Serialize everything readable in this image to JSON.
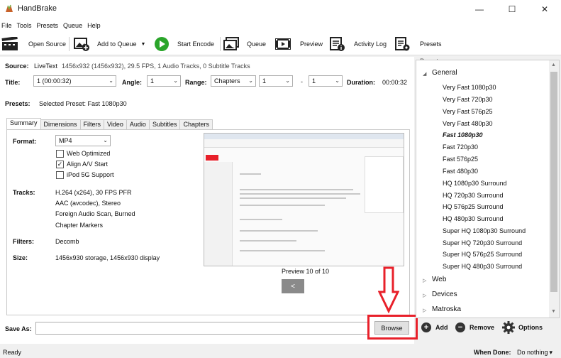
{
  "window": {
    "title": "HandBrake",
    "minimize": "—",
    "maximize": "☐",
    "close": "✕"
  },
  "menu": [
    "File",
    "Tools",
    "Presets",
    "Queue",
    "Help"
  ],
  "toolbar": {
    "open_source": "Open Source",
    "add_to_queue": "Add to Queue",
    "add_to_queue_arrow": "▼",
    "start_encode": "Start Encode",
    "queue": "Queue",
    "preview": "Preview",
    "activity_log": "Activity Log",
    "presets": "Presets"
  },
  "source": {
    "label": "Source:",
    "name": "LiveText",
    "info": "1456x932 (1456x932), 29.5 FPS, 1 Audio Tracks, 0 Subtitle Tracks"
  },
  "title_row": {
    "title_label": "Title:",
    "title_value": "1 (00:00:32)",
    "angle_label": "Angle:",
    "angle_value": "1",
    "range_label": "Range:",
    "range_mode": "Chapters",
    "range_start": "1",
    "range_dash": "-",
    "range_end": "1",
    "duration_label": "Duration:",
    "duration_value": "00:00:32"
  },
  "presets_row": {
    "label": "Presets:",
    "selected": "Selected Preset: Fast 1080p30"
  },
  "tabs": [
    "Summary",
    "Dimensions",
    "Filters",
    "Video",
    "Audio",
    "Subtitles",
    "Chapters"
  ],
  "summary": {
    "format_label": "Format:",
    "format_value": "MP4",
    "web_optimized": "Web Optimized",
    "web_optimized_checked": false,
    "align_av": "Align A/V Start",
    "align_av_checked": true,
    "ipod": "iPod 5G Support",
    "ipod_checked": false,
    "tracks_label": "Tracks:",
    "tracks": [
      "H.264 (x264), 30 FPS PFR",
      "AAC (avcodec), Stereo",
      "Foreign Audio Scan, Burned",
      "Chapter Markers"
    ],
    "filters_label": "Filters:",
    "filters_value": "Decomb",
    "size_label": "Size:",
    "size_value": "1456x930 storage, 1456x930 display",
    "preview_caption": "Preview 10 of 10",
    "preview_prev": "<"
  },
  "save_as": {
    "label": "Save As:",
    "value": "",
    "browse": "Browse"
  },
  "presets_panel": {
    "header": "Presets",
    "groups": [
      {
        "name": "General",
        "expanded": true,
        "items": [
          "Very Fast 1080p30",
          "Very Fast 720p30",
          "Very Fast 576p25",
          "Very Fast 480p30",
          "Fast 1080p30",
          "Fast 720p30",
          "Fast 576p25",
          "Fast 480p30",
          "HQ 1080p30 Surround",
          "HQ 720p30 Surround",
          "HQ 576p25 Surround",
          "HQ 480p30 Surround",
          "Super HQ 1080p30 Surround",
          "Super HQ 720p30 Surround",
          "Super HQ 576p25 Surround",
          "Super HQ 480p30 Surround"
        ],
        "selected": "Fast 1080p30"
      },
      {
        "name": "Web",
        "expanded": false
      },
      {
        "name": "Devices",
        "expanded": false
      },
      {
        "name": "Matroska",
        "expanded": false
      }
    ],
    "add": "Add",
    "remove": "Remove",
    "options": "Options"
  },
  "status": {
    "text": "Ready",
    "when_done_label": "When Done:",
    "when_done_value": "Do nothing",
    "when_done_arrow": "▾"
  },
  "colors": {
    "accent": "#e8202a",
    "start_green": "#2aa52a",
    "browse_bg": "#e1e1e1"
  }
}
